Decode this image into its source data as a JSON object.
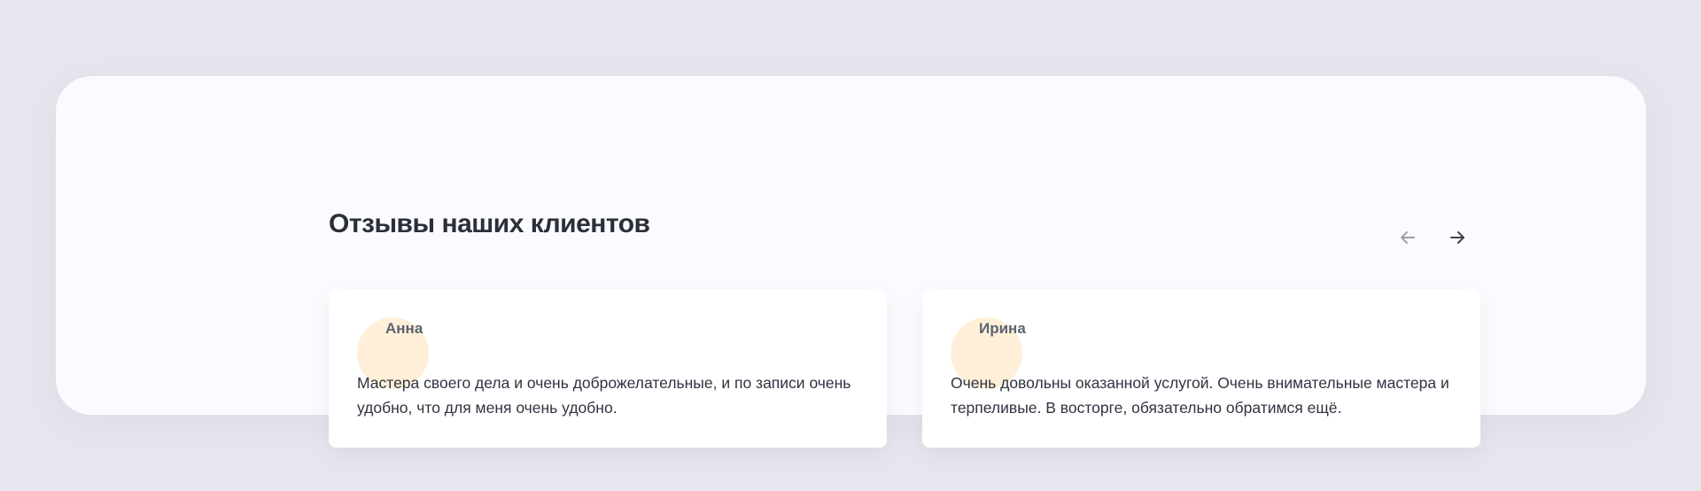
{
  "section": {
    "title": "Отзывы наших клиентов"
  },
  "navigation": {
    "prev_icon": "arrow-left-icon",
    "next_icon": "arrow-right-icon",
    "prev_color": "#9aa0ab",
    "next_color": "#3b4250"
  },
  "reviews": [
    {
      "name": "Анна",
      "text": "Мастера своего дела и очень доброжелательные, и по записи очень удобно, что для меня очень удобно."
    },
    {
      "name": "Ирина",
      "text": "Очень довольны оказанной услугой. Очень внимательные мастера и терпеливые. В восторге, обязательно обратимся ещё."
    }
  ],
  "colors": {
    "page_background": "#e7e6ee",
    "panel_background": "#fbfbff",
    "card_background": "#ffffff",
    "avatar_accent": "#ffefd9",
    "title_text": "#2a2f3a",
    "name_text": "#5b6470",
    "body_text": "#2e3440"
  }
}
